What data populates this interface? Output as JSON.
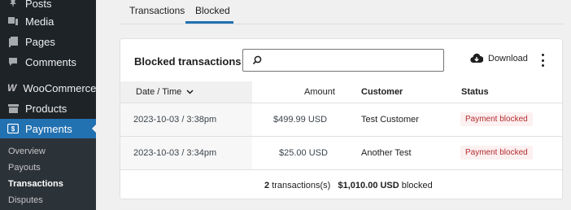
{
  "sidebar": {
    "items": [
      {
        "label": "Posts",
        "icon": "pin-icon"
      },
      {
        "label": "Media",
        "icon": "media-icon"
      },
      {
        "label": "Pages",
        "icon": "pages-icon"
      },
      {
        "label": "Comments",
        "icon": "comments-icon"
      },
      {
        "label": "WooCommerce",
        "icon": "woocommerce-icon"
      },
      {
        "label": "Products",
        "icon": "products-icon"
      },
      {
        "label": "Payments",
        "icon": "payments-icon"
      }
    ],
    "submenu": [
      "Overview",
      "Payouts",
      "Transactions",
      "Disputes"
    ]
  },
  "tabs": [
    "Transactions",
    "Blocked"
  ],
  "card": {
    "title": "Blocked transactions",
    "search_placeholder": "",
    "download_label": "Download"
  },
  "table": {
    "columns": [
      "Date / Time",
      "Amount",
      "Customer",
      "Status"
    ],
    "rows": [
      {
        "datetime": "2023-10-03 / 3:38pm",
        "amount": "$499.99 USD",
        "customer": "Test Customer",
        "status": "Payment blocked"
      },
      {
        "datetime": "2023-10-03 / 3:34pm",
        "amount": "$25.00 USD",
        "customer": "Another Test",
        "status": "Payment blocked"
      }
    ],
    "footer": {
      "count": "2",
      "count_suffix": "transactions(s)",
      "total": "$1,010.00 USD",
      "total_suffix": "blocked"
    }
  },
  "colors": {
    "accent": "#2271b1",
    "sidebar_bg": "#1d2327",
    "status_text": "#b32d2e",
    "status_bg": "#fcf0f1"
  }
}
